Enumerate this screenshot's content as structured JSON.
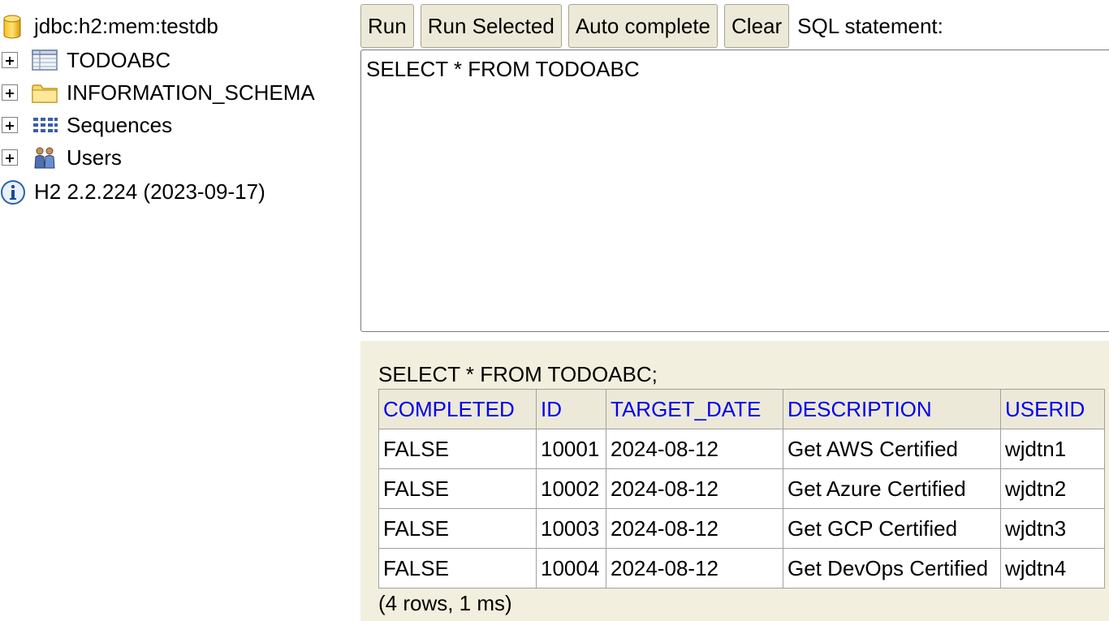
{
  "tree": {
    "connection": "jdbc:h2:mem:testdb",
    "items": [
      {
        "label": "TODOABC",
        "icon": "table-icon"
      },
      {
        "label": "INFORMATION_SCHEMA",
        "icon": "folder-icon"
      },
      {
        "label": "Sequences",
        "icon": "sequences-icon"
      },
      {
        "label": "Users",
        "icon": "users-icon"
      }
    ],
    "version": "H2 2.2.224 (2023-09-17)"
  },
  "toolbar": {
    "run_label": "Run",
    "run_selected_label": "Run Selected",
    "auto_complete_label": "Auto complete",
    "clear_label": "Clear",
    "sql_statement_label": "SQL statement:"
  },
  "editor": {
    "value": "SELECT * FROM TODOABC"
  },
  "result": {
    "query": "SELECT * FROM TODOABC;",
    "columns": [
      "COMPLETED",
      "ID",
      "TARGET_DATE",
      "DESCRIPTION",
      "USERID"
    ],
    "rows": [
      [
        "FALSE",
        "10001",
        "2024-08-12",
        "Get AWS Certified",
        "wjdtn1"
      ],
      [
        "FALSE",
        "10002",
        "2024-08-12",
        "Get Azure Certified",
        "wjdtn2"
      ],
      [
        "FALSE",
        "10003",
        "2024-08-12",
        "Get GCP Certified",
        "wjdtn3"
      ],
      [
        "FALSE",
        "10004",
        "2024-08-12",
        "Get DevOps Certified",
        "wjdtn4"
      ]
    ],
    "footer": "(4 rows, 1 ms)"
  },
  "colors": {
    "header_link": "#0000ee",
    "result_background": "#f2efde",
    "button_background": "#ece9d8"
  }
}
